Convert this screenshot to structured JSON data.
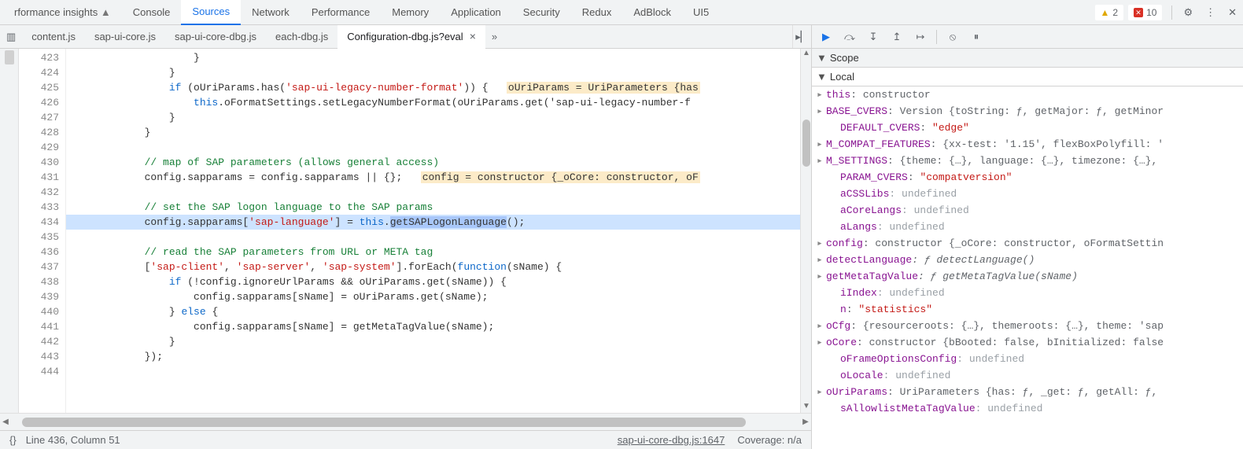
{
  "tabs": {
    "items": [
      "rformance insights",
      "Console",
      "Sources",
      "Network",
      "Performance",
      "Memory",
      "Application",
      "Security",
      "Redux",
      "AdBlock",
      "UI5"
    ],
    "activeIndex": 2,
    "perfIcon": "▲"
  },
  "topStatus": {
    "warnCount": "2",
    "errCount": "10",
    "errX": "✕"
  },
  "fileTabs": {
    "items": [
      "content.js",
      "sap-ui-core.js",
      "sap-ui-core-dbg.js",
      "each-dbg.js",
      "Configuration-dbg.js?eval"
    ],
    "activeIndex": 4,
    "closeGlyph": "×",
    "overflowGlyph": "»",
    "navLeft": "⇤",
    "navRight": "⇲"
  },
  "code": {
    "startLine": 423,
    "highlightLine": 434,
    "lines": [
      {
        "n": 423,
        "t": "                    }"
      },
      {
        "n": 424,
        "t": "                }"
      },
      {
        "n": 425,
        "t": "                if (oUriParams.has('sap-ui-legacy-number-format')) {   oUriParams = UriParameters {has"
      },
      {
        "n": 426,
        "t": "                    this.oFormatSettings.setLegacyNumberFormat(oUriParams.get('sap-ui-legacy-number-f"
      },
      {
        "n": 427,
        "t": "                }"
      },
      {
        "n": 428,
        "t": "            }"
      },
      {
        "n": 429,
        "t": ""
      },
      {
        "n": 430,
        "t": "            // map of SAP parameters (allows general access)"
      },
      {
        "n": 431,
        "t": "            config.sapparams = config.sapparams || {};   config = constructor {_oCore: constructor, oF"
      },
      {
        "n": 432,
        "t": ""
      },
      {
        "n": 433,
        "t": "            // set the SAP logon language to the SAP params"
      },
      {
        "n": 434,
        "t": "            config.sapparams['sap-language'] = this.getSAPLogonLanguage();"
      },
      {
        "n": 435,
        "t": ""
      },
      {
        "n": 436,
        "t": "            // read the SAP parameters from URL or META tag"
      },
      {
        "n": 437,
        "t": "            ['sap-client', 'sap-server', 'sap-system'].forEach(function(sName) {"
      },
      {
        "n": 438,
        "t": "                if (!config.ignoreUrlParams && oUriParams.get(sName)) {"
      },
      {
        "n": 439,
        "t": "                    config.sapparams[sName] = oUriParams.get(sName);"
      },
      {
        "n": 440,
        "t": "                } else {"
      },
      {
        "n": 441,
        "t": "                    config.sapparams[sName] = getMetaTagValue(sName);"
      },
      {
        "n": 442,
        "t": "                }"
      },
      {
        "n": 443,
        "t": "            });"
      },
      {
        "n": 444,
        "t": ""
      }
    ]
  },
  "status": {
    "bracesIcon": "{}",
    "cursor": "Line 436, Column 51",
    "link": "sap-ui-core-dbg.js:1647",
    "coverage": "Coverage: n/a"
  },
  "debugger": {
    "icons": {
      "resume": "▶",
      "stepOver": "⤼",
      "stepInto": "↧",
      "stepOut": "↥",
      "step": "↦",
      "deactivate": "⦸",
      "pause": "⏸"
    },
    "scopeLabel": "Scope",
    "localLabel": "Local",
    "entries": [
      {
        "exp": true,
        "k": "this",
        "v": ": constructor"
      },
      {
        "exp": true,
        "k": "BASE_CVERS",
        "v": ": Version {toString: ƒ, getMajor: ƒ, getMinor"
      },
      {
        "exp": false,
        "indent": true,
        "k": "DEFAULT_CVERS",
        "vs": ": \"edge\""
      },
      {
        "exp": true,
        "k": "M_COMPAT_FEATURES",
        "v": ": {xx-test: '1.15', flexBoxPolyfill: '"
      },
      {
        "exp": true,
        "k": "M_SETTINGS",
        "v": ": {theme: {…}, language: {…}, timezone: {…},"
      },
      {
        "exp": false,
        "indent": true,
        "k": "PARAM_CVERS",
        "vs": ": \"compatversion\""
      },
      {
        "exp": false,
        "indent": true,
        "k": "aCSSLibs",
        "vn": ": undefined"
      },
      {
        "exp": false,
        "indent": true,
        "k": "aCoreLangs",
        "vn": ": undefined"
      },
      {
        "exp": false,
        "indent": true,
        "k": "aLangs",
        "vn": ": undefined"
      },
      {
        "exp": true,
        "k": "config",
        "v": ": constructor {_oCore: constructor, oFormatSettin"
      },
      {
        "exp": true,
        "k": "detectLanguage",
        "fnv": ": ƒ detectLanguage()"
      },
      {
        "exp": true,
        "k": "getMetaTagValue",
        "fnv": ": ƒ getMetaTagValue(sName)"
      },
      {
        "exp": false,
        "indent": true,
        "k": "iIndex",
        "vn": ": undefined"
      },
      {
        "exp": false,
        "indent": true,
        "k": "n",
        "vs": ": \"statistics\""
      },
      {
        "exp": true,
        "k": "oCfg",
        "v": ": {resourceroots: {…}, themeroots: {…}, theme: 'sap"
      },
      {
        "exp": true,
        "k": "oCore",
        "v": ": constructor {bBooted: false, bInitialized: false"
      },
      {
        "exp": false,
        "indent": true,
        "k": "oFrameOptionsConfig",
        "vn": ": undefined"
      },
      {
        "exp": false,
        "indent": true,
        "k": "oLocale",
        "vn": ": undefined"
      },
      {
        "exp": true,
        "k": "oUriParams",
        "v": ": UriParameters {has: ƒ, _get: ƒ, getAll: ƒ,"
      },
      {
        "exp": false,
        "indent": true,
        "k": "sAllowlistMetaTagValue",
        "vn": ": undefined"
      }
    ]
  }
}
